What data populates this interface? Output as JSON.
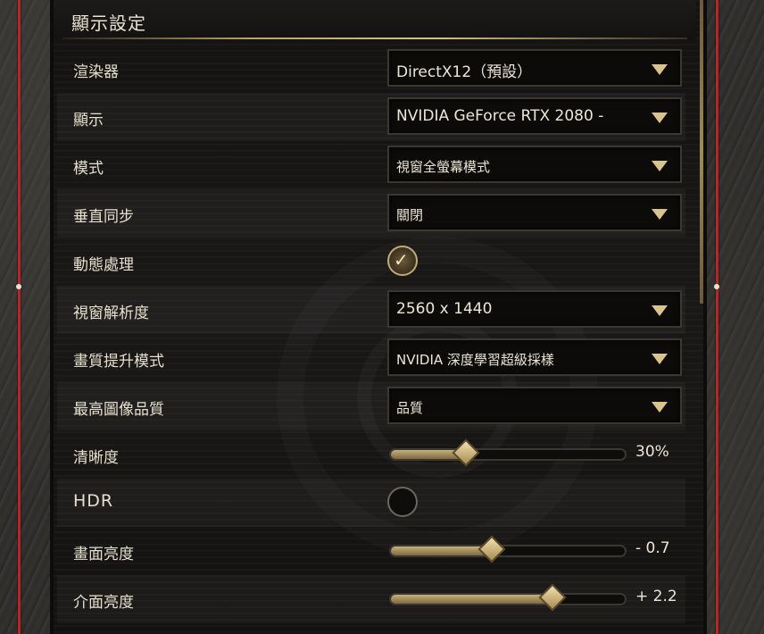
{
  "panel": {
    "title": "顯示設定"
  },
  "settings": [
    {
      "label": "渲染器",
      "type": "dropdown",
      "value": "DirectX12（預設）"
    },
    {
      "label": "顯示",
      "type": "dropdown",
      "value": "NVIDIA GeForce RTX 2080 -"
    },
    {
      "label": "模式",
      "type": "dropdown",
      "value": "視窗全螢幕模式"
    },
    {
      "label": "垂直同步",
      "type": "dropdown",
      "value": "關閉"
    },
    {
      "label": "動態處理",
      "type": "checkbox",
      "checked": true
    },
    {
      "label": "視窗解析度",
      "type": "dropdown",
      "value": "2560 x 1440"
    },
    {
      "label": "畫質提升模式",
      "type": "dropdown",
      "value": "NVIDIA 深度學習超級採樣"
    },
    {
      "label": "最高圖像品質",
      "type": "dropdown",
      "value": "品質"
    },
    {
      "label": "清晰度",
      "type": "slider",
      "value": "30%",
      "fraction": 0.32
    },
    {
      "label": "HDR",
      "type": "checkbox",
      "checked": false
    },
    {
      "label": "畫面亮度",
      "type": "slider",
      "value": "- 0.7",
      "fraction": 0.43
    },
    {
      "label": "介面亮度",
      "type": "slider",
      "value": "+ 2.2",
      "fraction": 0.69
    }
  ],
  "icons": {
    "dropdown": "chevron-down-icon",
    "check": "checkmark-icon"
  },
  "colors": {
    "accent": "#c2ac76",
    "frame_red": "#b5262a",
    "text": "#e6dfcd"
  }
}
